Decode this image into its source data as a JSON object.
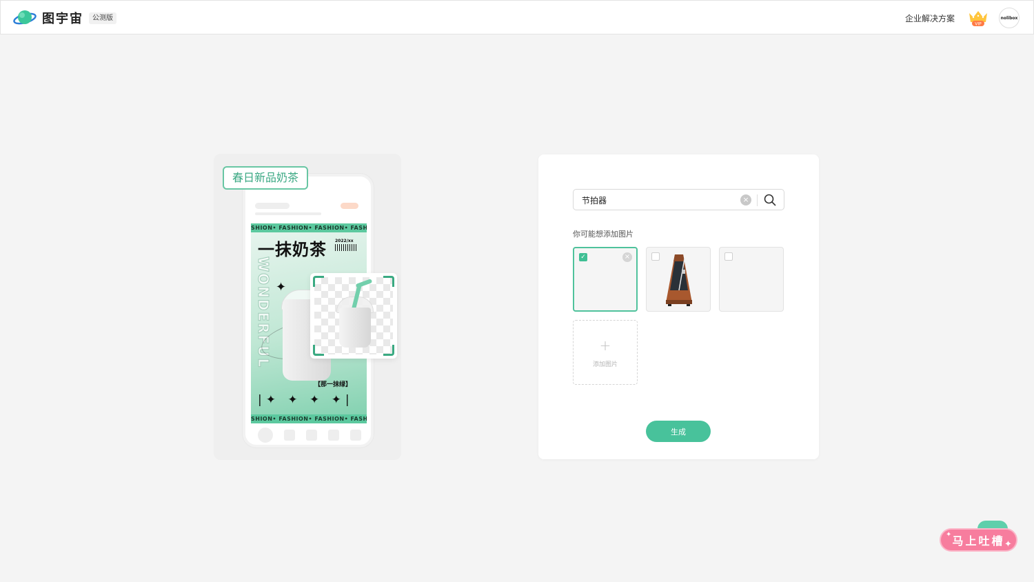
{
  "header": {
    "logo_text": "图宇宙",
    "beta_badge": "公测版",
    "enterprise_link": "企业解决方案",
    "vip_label": "VIP",
    "avatar_text": "nolibox"
  },
  "showcase": {
    "tag_label": "春日新品奶茶",
    "ticker_text": "SHION• FASHION• FASHION• FASHIC",
    "poster_title": "一抹奶茶",
    "poster_year": "2022/xx",
    "vertical_word": "WONDERFUL",
    "poster_slogan": "【那一抹绿】",
    "stars_row": "|✦ ✦ ✦ ✦|"
  },
  "panel": {
    "search": {
      "value": "节拍器",
      "clear_glyph": "×"
    },
    "suggest_label": "你可能想添加图片",
    "thumbs": [
      {
        "state": "checked",
        "content": "empty"
      },
      {
        "state": "unchecked",
        "content": "metronome"
      },
      {
        "state": "unchecked",
        "content": "empty"
      }
    ],
    "check_glyph": "✓",
    "remove_glyph": "×",
    "add_tile": {
      "plus": "+",
      "label": "添加图片"
    },
    "generate_label": "生成"
  },
  "feedback": {
    "label": "马上吐槽",
    "spark": "✦"
  },
  "colors": {
    "accent": "#48c29b",
    "feedback": "#f77d9e",
    "background": "#f4f4f4"
  }
}
